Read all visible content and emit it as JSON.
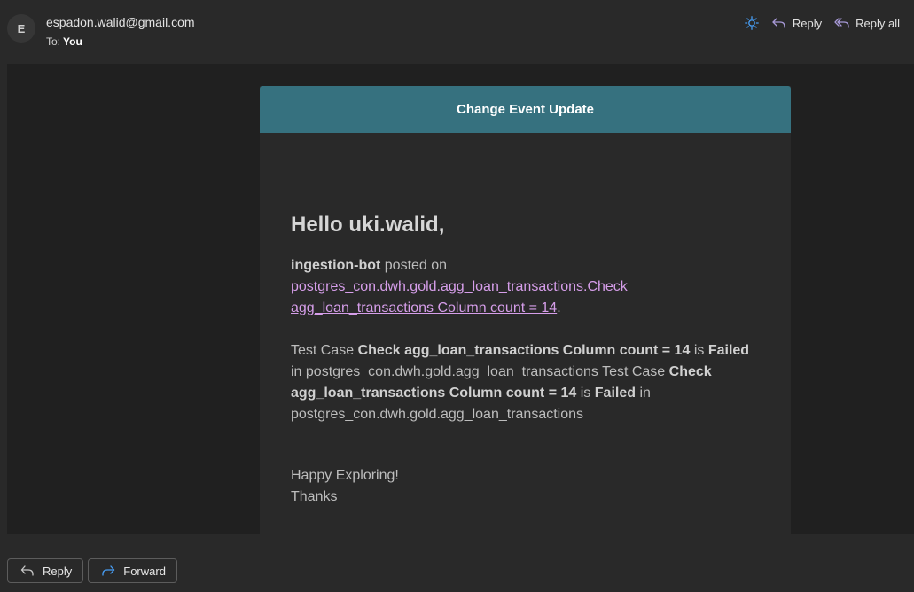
{
  "header": {
    "avatar_initial": "E",
    "sender": "espadon.walid@gmail.com",
    "to_label": "To:",
    "to_value": "You",
    "actions": {
      "reply_label": "Reply",
      "reply_all_label": "Reply all"
    }
  },
  "email": {
    "banner_title": "Change Event Update",
    "greeting": "Hello uki.walid,",
    "p1": {
      "user": "ingestion-bot",
      "posted_on": "posted on",
      "link_line1": "postgres_con.dwh.gold.agg_loan_transactions.Check",
      "link_line2": "agg_loan_transactions Column count = 14",
      "period": "."
    },
    "p2": {
      "t1": "Test Case",
      "b1": "Check agg_loan_transactions Column count = 14",
      "t2": "is",
      "b2": "Failed",
      "t3": "in postgres_con.dwh.gold.agg_loan_transactions Test Case",
      "b3": "Check agg_loan_transactions Column count = 14",
      "t4": "is",
      "b4": "Failed",
      "t5": "in postgres_con.dwh.gold.agg_loan_transactions"
    },
    "p3": {
      "line1": "Happy Exploring!",
      "line2": "Thanks"
    }
  },
  "footer": {
    "reply_label": "Reply",
    "forward_label": "Forward"
  },
  "colors": {
    "banner": "#36717f",
    "link": "#d69eea",
    "icon_accent": "#479ef5",
    "reply_icon": "#a89ad8"
  },
  "icons": [
    "sun-icon",
    "reply-icon",
    "reply-all-icon",
    "forward-icon"
  ]
}
